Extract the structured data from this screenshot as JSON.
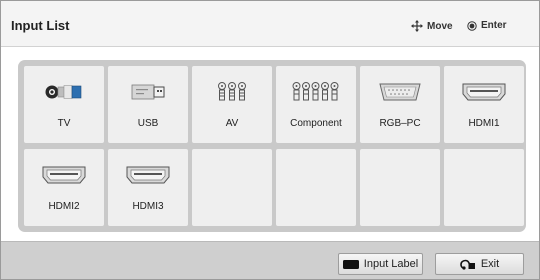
{
  "header": {
    "title": "Input List",
    "move_label": "Move",
    "enter_label": "Enter",
    "move_icon": "dpad-arrows-icon",
    "enter_icon": "ok-button-icon"
  },
  "inputs": [
    {
      "label": "TV",
      "icon": "tv-antenna-icon"
    },
    {
      "label": "USB",
      "icon": "usb-icon"
    },
    {
      "label": "AV",
      "icon": "av-rca-icon"
    },
    {
      "label": "Component",
      "icon": "component-rca-icon"
    },
    {
      "label": "RGB–PC",
      "icon": "rgb-pc-icon"
    },
    {
      "label": "HDMI1",
      "icon": "hdmi-icon"
    },
    {
      "label": "HDMI2",
      "icon": "hdmi-icon"
    },
    {
      "label": "HDMI3",
      "icon": "hdmi-icon"
    },
    {
      "label": "",
      "icon": ""
    },
    {
      "label": "",
      "icon": ""
    },
    {
      "label": "",
      "icon": ""
    },
    {
      "label": "",
      "icon": ""
    }
  ],
  "footer": {
    "input_label_button": "Input Label",
    "exit_button": "Exit",
    "input_label_icon": "black-key-icon",
    "exit_icon": "back-arrow-icon"
  },
  "colors": {
    "panel": "#c9c9c9",
    "tile": "#efefef",
    "header": "#f4f4f4",
    "footer": "#cfcfcf"
  }
}
